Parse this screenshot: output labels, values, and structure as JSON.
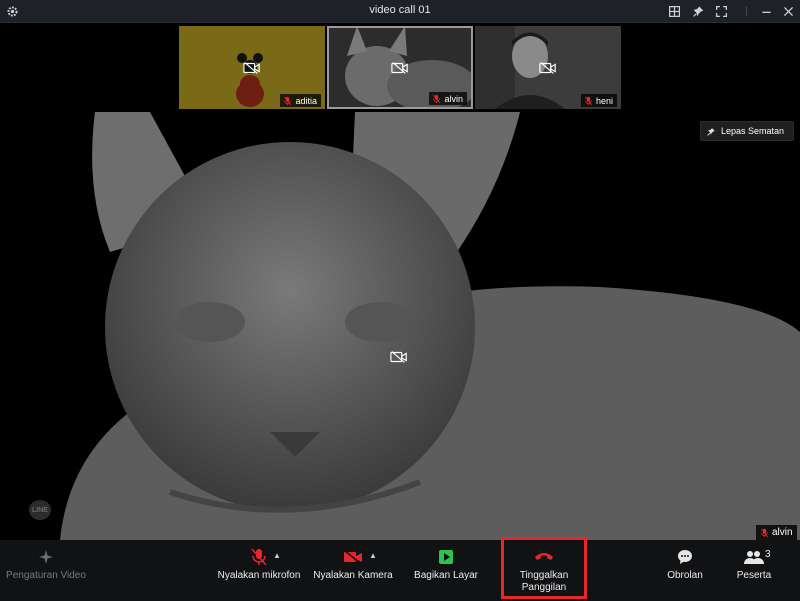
{
  "window": {
    "title": "video call 01"
  },
  "participants": [
    {
      "name": "aditia"
    },
    {
      "name": "alvin"
    },
    {
      "name": "heni"
    }
  ],
  "pin_button": {
    "label": "Lepas Sematan"
  },
  "main_video": {
    "speaker": "alvin",
    "watermark": "LINE"
  },
  "toolbar": {
    "video_settings": "Pengaturan Video",
    "mic": "Nyalakan mikrofon",
    "camera": "Nyalakan Kamera",
    "share": "Bagikan Layar",
    "leave_line1": "Tinggalkan",
    "leave_line2": "Panggilan",
    "chat": "Obrolan",
    "participants": "Peserta",
    "participant_count": "3"
  },
  "colors": {
    "accent_red": "#e8262b",
    "share_green": "#31c24d",
    "titlebar": "#1e2127"
  },
  "icons": [
    "settings-icon",
    "grid-icon",
    "pin-icon",
    "fullscreen-icon",
    "minimize-icon",
    "close-icon",
    "camera-off-icon",
    "mic-off-icon",
    "sparkle-icon",
    "screen-share-icon",
    "phone-hangup-icon",
    "chat-bubble-icon",
    "people-icon"
  ]
}
